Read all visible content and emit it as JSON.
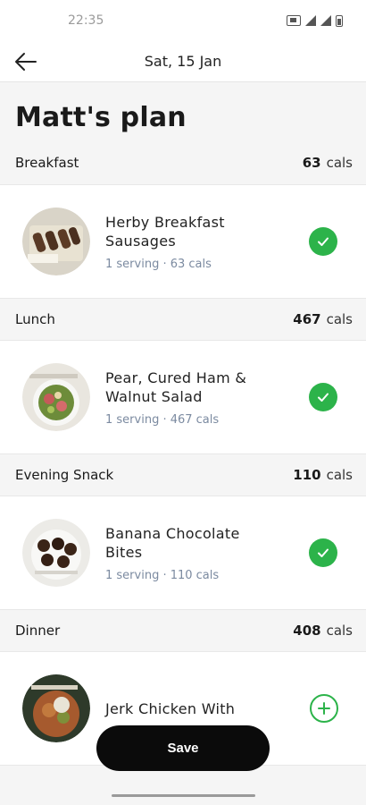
{
  "status_bar": {
    "time": "22:35"
  },
  "header": {
    "date": "Sat, 15 Jan"
  },
  "page": {
    "title": "Matt's plan"
  },
  "sections": [
    {
      "name": "Breakfast",
      "cals": "63",
      "unit": "cals",
      "meal": {
        "name": "Herby Breakfast Sausages",
        "serving": "1 serving · 63 cals",
        "status": "done"
      }
    },
    {
      "name": "Lunch",
      "cals": "467",
      "unit": "cals",
      "meal": {
        "name": "Pear, Cured Ham & Walnut Salad",
        "serving": "1 serving · 467 cals",
        "status": "done"
      }
    },
    {
      "name": "Evening Snack",
      "cals": "110",
      "unit": "cals",
      "meal": {
        "name": "Banana Chocolate Bites",
        "serving": "1 serving · 110 cals",
        "status": "done"
      }
    },
    {
      "name": "Dinner",
      "cals": "408",
      "unit": "cals",
      "meal": {
        "name": "Jerk Chicken With",
        "status": "add"
      }
    }
  ],
  "actions": {
    "save_label": "Save"
  },
  "colors": {
    "accent_green": "#2cb34a",
    "button_black": "#0b0b0b",
    "subtext": "#7b8aa0"
  },
  "icons": [
    "back-arrow-icon",
    "check-icon",
    "plus-icon",
    "sim-icon",
    "signal-icon",
    "battery-icon"
  ]
}
